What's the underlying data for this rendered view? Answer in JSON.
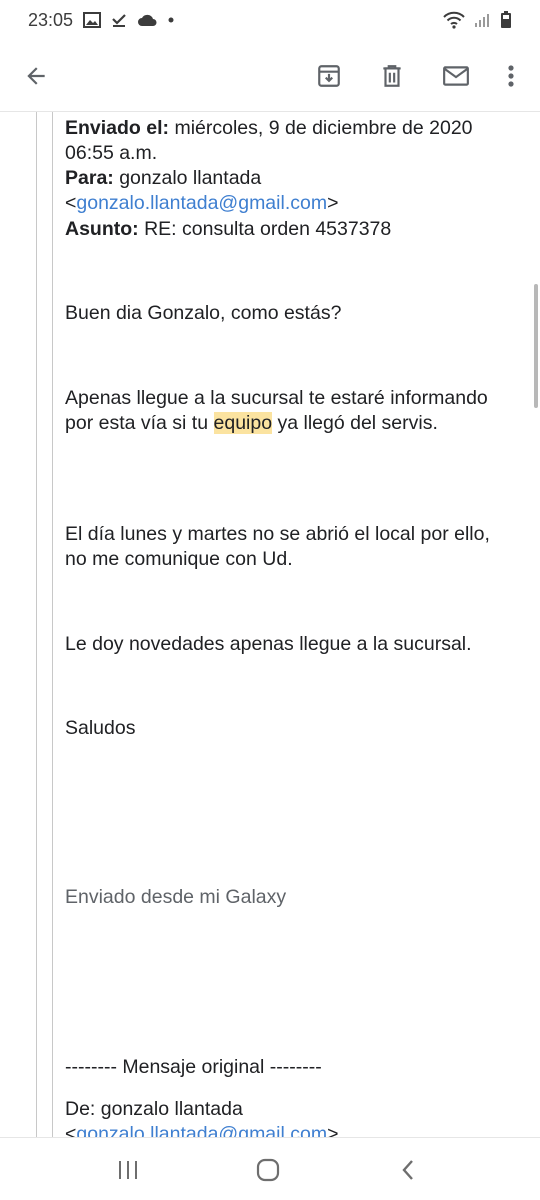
{
  "status_bar": {
    "time": "23:05",
    "icons": [
      "image-icon",
      "download-done-icon",
      "cloud-icon",
      "dot-icon",
      "wifi-icon",
      "signal-icon",
      "battery-icon"
    ]
  },
  "toolbar": {
    "back_icon": "arrow-back-icon",
    "actions": [
      "archive-icon",
      "delete-icon",
      "mail-icon",
      "more-vert-icon"
    ]
  },
  "email": {
    "sent_label": "Enviado el:",
    "sent_value": " miércoles, 9 de diciembre de 2020 06:55 a.m.",
    "to_label": "Para:",
    "to_name": " gonzalo llantada",
    "to_email_open": "<",
    "to_email": "gonzalo.llantada@gmail.com",
    "to_email_close": ">",
    "subject_label": "Asunto:",
    "subject_value": " RE: consulta orden 4537378",
    "greeting": "Buen dia Gonzalo, como estás?",
    "para1_before": "Apenas llegue a la sucursal te estaré informando por esta vía si tu ",
    "para1_highlight": "equipo",
    "para1_after": " ya llegó del servis.",
    "para2": "El día lunes y martes no se abrió el local por ello, no me comunique con Ud.",
    "para3": "Le doy novedades apenas llegue a la sucursal.",
    "closing": "Saludos",
    "signature": "Enviado desde mi Galaxy",
    "original_separator": "-------- Mensaje original --------",
    "from_line": "De: gonzalo llantada",
    "from_email_open": "<",
    "from_email": "gonzalo.llantada@gmail.com",
    "from_email_close": ">"
  },
  "navbar": {
    "icons": [
      "recent-apps-icon",
      "home-icon",
      "back-icon"
    ]
  }
}
